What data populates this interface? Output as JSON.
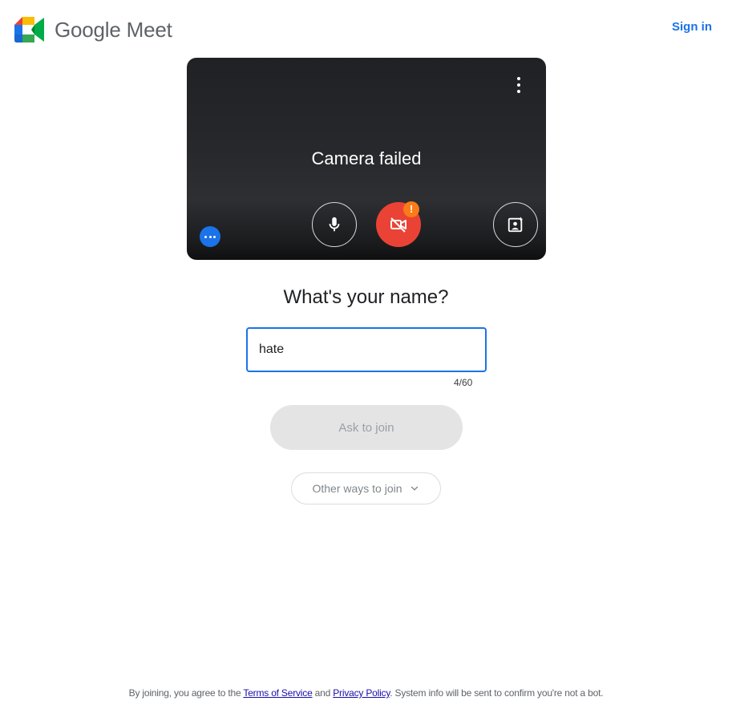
{
  "header": {
    "brand": "Google Meet",
    "sign_in": "Sign in"
  },
  "preview": {
    "status": "Camera failed",
    "warning_badge": "!"
  },
  "join": {
    "heading": "What's your name?",
    "name_value": "hate",
    "counter": "4/60",
    "ask_to_join": "Ask to join",
    "other_ways": "Other ways to join"
  },
  "footer": {
    "prefix": "By joining, you agree to the ",
    "terms": "Terms of Service",
    "and": " and ",
    "privacy": "Privacy Policy",
    "suffix": ". System info will be sent to confirm you're not a bot."
  },
  "colors": {
    "accent": "#1a73e8",
    "camera_off": "#ea4335",
    "warning": "#fa7b17"
  },
  "icons": {
    "logo": "google-meet-logo",
    "mic": "microphone-icon",
    "camera": "camera-off-icon",
    "effects": "visual-effects-icon",
    "more": "more-options-icon",
    "kebab": "vertical-dots-icon",
    "chevron": "chevron-down-icon"
  }
}
